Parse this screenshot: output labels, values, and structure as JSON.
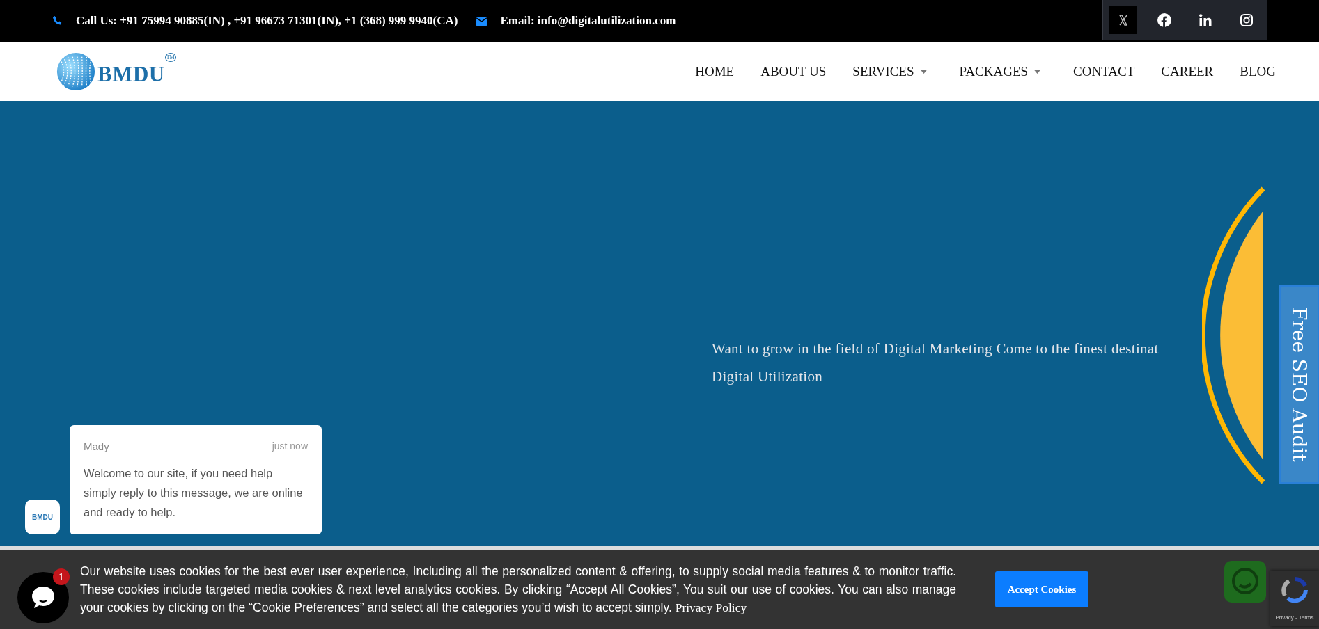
{
  "top_bar": {
    "phone": "Call Us: +91 75994 90885(IN) , +91 96673 71301(IN), +1 (368) 999 9940(CA)",
    "email": "Email: info@digitalutilization.com",
    "social": [
      {
        "kind": "x"
      },
      {
        "kind": "facebook"
      },
      {
        "kind": "linkedin"
      },
      {
        "kind": "instagram"
      }
    ]
  },
  "header": {
    "logo": {
      "text": "BMDU",
      "mark": "TM"
    },
    "nav": [
      {
        "label": "HOME",
        "has_dropdown": false
      },
      {
        "label": "ABOUT US",
        "has_dropdown": false
      },
      {
        "label": "SERVICES",
        "has_dropdown": true
      },
      {
        "label": "PACKAGES",
        "has_dropdown": true
      },
      {
        "label": "CONTACT",
        "has_dropdown": false
      },
      {
        "label": "CAREER",
        "has_dropdown": false
      },
      {
        "label": "BLOG",
        "has_dropdown": false
      }
    ]
  },
  "hero": {
    "lines": [
      "Want to grow in the field of Digital Marketing Come to the finest destinat",
      "Digital Utilization"
    ]
  },
  "side_tab": "Free SEO Audit",
  "chat": {
    "avatar_text": "BMDU",
    "sender": "Mady",
    "time": "just now",
    "message": "Welcome to our site, if you need help simply reply to this message, we are online and ready to help.",
    "unread": "1"
  },
  "cookie_bar": {
    "text": "Our website uses cookies for the best ever user experience, Including all the personalized content & offering, to supply social media features & to monitor traffic. These cookies include targeted media cookies & next level analytics cookies. By clicking “Accept All Cookies”, You suit our use of cookies. You can also manage your cookies by clicking on the “Cookie Preferences” and select all the categories you’d wish to accept simply.",
    "link": "Privacy Policy",
    "button": "Accept Cookies"
  },
  "recaptcha": {
    "text": "Privacy - Terms"
  }
}
